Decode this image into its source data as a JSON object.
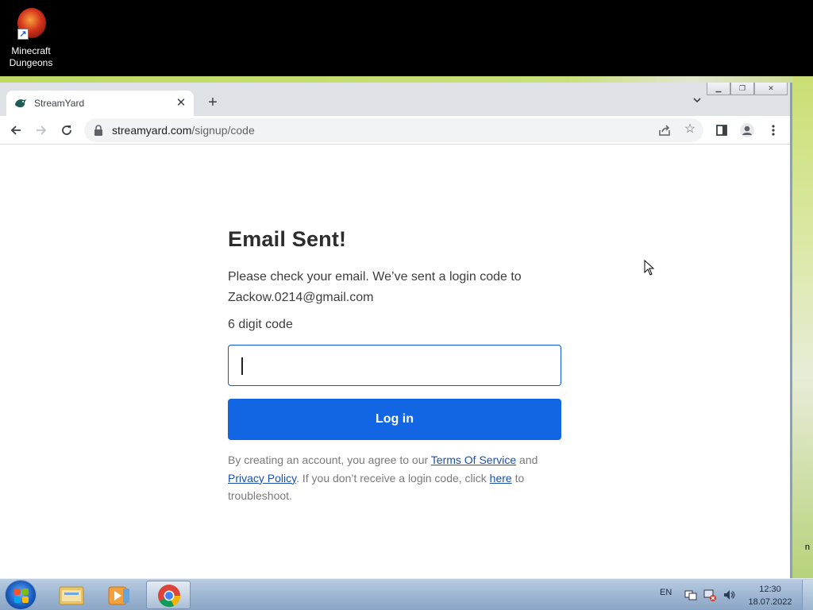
{
  "desktop": {
    "icons": [
      {
        "label_line1": "Minecraft",
        "label_line2": "Dungeons",
        "icon": "minecraft-dungeons-icon"
      }
    ],
    "right_edge_text": "n"
  },
  "browser": {
    "tab": {
      "title": "StreamYard",
      "favicon": "streamyard-logo-icon"
    },
    "address": {
      "host": "streamyard.com",
      "path": "/signup/code"
    }
  },
  "page": {
    "heading": "Email Sent!",
    "message": "Please check your email. We’ve sent a login code to Zackow.0214@gmail.com",
    "code_label": "6 digit code",
    "code_value": "",
    "login_button": "Log in",
    "legal": {
      "prefix": "By creating an account, you agree to our ",
      "terms_link": "Terms Of Service",
      "and": " and ",
      "privacy_link": "Privacy Policy",
      "middle": ". If you don’t receive a login code, click ",
      "here_link": "here",
      "suffix": " to troubleshoot."
    }
  },
  "taskbar": {
    "apps": [
      "windows-explorer-icon",
      "media-player-icon",
      "chrome-icon"
    ],
    "active_app": "chrome-icon",
    "language": "EN",
    "time": "12:30",
    "date": "18.07.2022"
  },
  "colors": {
    "accent_button": "#1266e3",
    "input_border": "#0b57d0",
    "link": "#1a4fb0"
  }
}
